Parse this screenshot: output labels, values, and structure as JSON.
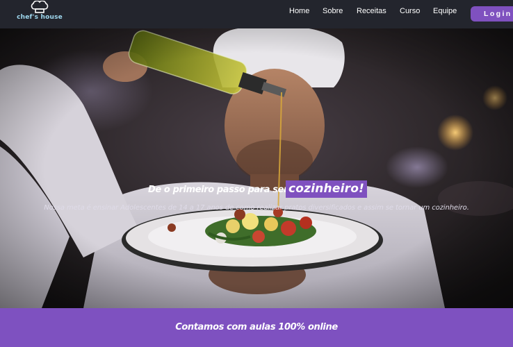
{
  "navbar": {
    "logo_text": "chef's house",
    "links": [
      "Home",
      "Sobre",
      "Receitas",
      "Curso",
      "Equipe"
    ],
    "login_label": "Login"
  },
  "hero": {
    "headline": "De o primeiro passo para ser um",
    "headline_highlight": "cozinheiro!",
    "subtitle": "Nossa meta é ensinar Adolescentes de 14 a 17 anos de como realizar pratos diversificados e assim se tornar um cozinheiro.",
    "image_alt": "chef pouring olive oil over a plated dish"
  },
  "banner": {
    "text": "Contamos com aulas 100% online"
  },
  "colors": {
    "navbar_bg": "#23252d",
    "accent": "#7f51bf",
    "logo_text": "#9fd8ef"
  }
}
